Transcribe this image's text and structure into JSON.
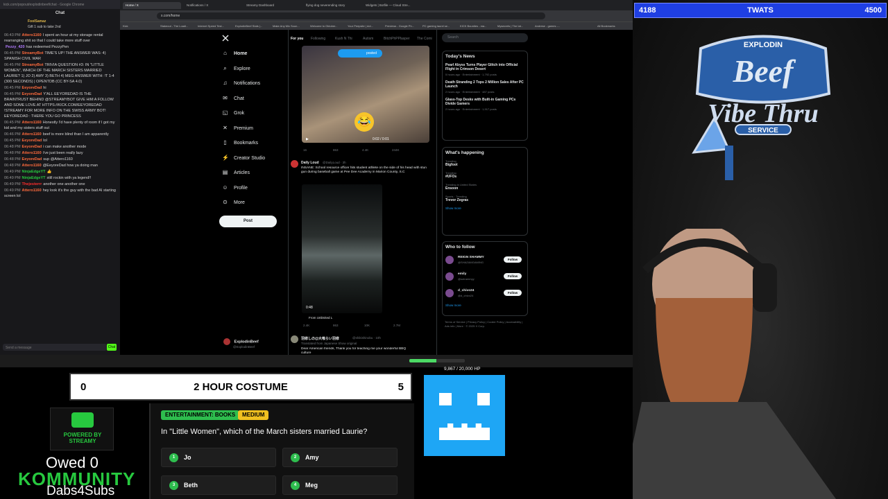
{
  "chat": {
    "window_title": "kick.com/popout/explodinbeef/chat - Google Chrome",
    "title": "Chat",
    "gift_user": "FoolSamaz",
    "gift_text": "Gift 1 sub to take 2nd",
    "messages": [
      {
        "time": "06:43 PM",
        "user": "Attero1160",
        "text": "I spent an hour at my storage rental rearranging shit so that I could take more stuff over",
        "color": "#ff6b3d"
      },
      {
        "time": "",
        "user": "Pezzy_420",
        "text": "has redeemed PezzyPen",
        "color": "#b37cff"
      },
      {
        "time": "06:45 PM",
        "user": "StreamyBot",
        "text": "TIME'S UP! THE ANSWER WAS: 4) SPANISH CIVIL WAR",
        "color": "#ff6b3d"
      },
      {
        "time": "06:45 PM",
        "user": "StreamyBot",
        "text": "TRIVIA QUESTION #3: IN \"LITTLE WOMEN\", WHICH OF THE MARCH SISTERS MARRIED LAURIE? 1) JO 2) AMY 3) BETH 4) MEG ANSWER WITH: !T 1-4 (300 SECONDS) | OPENTDB (CC BY-SA 4.0)",
        "color": "#ff6b3d"
      },
      {
        "time": "06:45 PM",
        "user": "EeyoreDad",
        "text": "hi",
        "color": "#ff6b3d"
      },
      {
        "time": "06:45 PM",
        "user": "EeyoreDad",
        "text": "Y'ALL EEYOREDAD IS THE BRAINTRUST BEHIND @STREAMYBOT GIVE HIM A FOLLOW AND SOME LOVE AT HTTPS://KICK.COM/EEYOREDAD !STREAMY FOR MORE INFO ON THE SWISS ARMY BOT! EEYOREDAD : THERE YOU GO PRINCESS",
        "color": "#ff6b3d"
      },
      {
        "time": "06:45 PM",
        "user": "Attero1160",
        "text": "Honestly I'd have plenty of room if I got my kid and my sisters stuff out",
        "color": "#ff6b3d"
      },
      {
        "time": "06:46 PM",
        "user": "Attero1160",
        "text": "beef is more blind than I am apparently",
        "color": "#ff6b3d"
      },
      {
        "time": "06:45 PM",
        "user": "EeyoreDad",
        "text": "lol",
        "color": "#ff6b3d"
      },
      {
        "time": "06:48 PM",
        "user": "EeyoreDad",
        "text": "i can make another mode",
        "color": "#ff6b3d"
      },
      {
        "time": "06:48 PM",
        "user": "Attero1160",
        "text": "i've just been really lazy",
        "color": "#ff6b3d"
      },
      {
        "time": "06:48 PM",
        "user": "EeyoreDad",
        "text": "sup @Attero1160",
        "color": "#ff6b3d"
      },
      {
        "time": "06:48 PM",
        "user": "Attero1160",
        "text": "@EeyoreDad how ya doing man",
        "color": "#ff6b3d"
      },
      {
        "time": "06:49 PM",
        "user": "NinjaEdgeYT",
        "text": "👍",
        "color": "#27c93f"
      },
      {
        "time": "06:49 PM",
        "user": "NinjaEdgeYT",
        "text": "still rockin with ya legend!!",
        "color": "#27c93f"
      },
      {
        "time": "06:49 PM",
        "user": "Thejesterrr",
        "text": "another one another one",
        "color": "#ff2d2d"
      },
      {
        "time": "06:49 PM",
        "user": "Attero1160",
        "text": "hey look it's the guy with the bad AI starting screen lol",
        "color": "#ff6b3d"
      }
    ],
    "input_placeholder": "Send a message",
    "send_label": "Chat"
  },
  "browser": {
    "tabs": [
      "Home / X",
      "Notifications / X",
      "Streamy Dashboard",
      "flying dog neverending story",
      "Widgets | Botfile — Cloud Stre...",
      ""
    ],
    "url": "x.com/home",
    "bookmarks": [
      "Kick",
      "Stakeout - The Loadi...",
      "Internet Speed Test...",
      "ExplodinBeef Stats |...",
      "Make Any Mix Soun...",
      "Welcome to Oktober...",
      "Your Peepsite | dot...",
      "Previews - Google Ph...",
      "PC gaming laurel se...",
      "KICK Bounties - ma...",
      "Mysecrets | The Iat...",
      "Andrese - games -...",
      "All Bookmarks"
    ]
  },
  "x": {
    "nav": [
      {
        "label": "Home",
        "icon": "home-icon",
        "glyph": "⌂"
      },
      {
        "label": "Explore",
        "icon": "search-icon",
        "glyph": "⌕"
      },
      {
        "label": "Notifications",
        "icon": "bell-icon",
        "glyph": "♫"
      },
      {
        "label": "Chat",
        "icon": "chat-icon",
        "glyph": "✉"
      },
      {
        "label": "Grok",
        "icon": "grok-icon",
        "glyph": "◱"
      },
      {
        "label": "Premium",
        "icon": "premium-icon",
        "glyph": "✕"
      },
      {
        "label": "Bookmarks",
        "icon": "bookmark-icon",
        "glyph": "▯"
      },
      {
        "label": "Creator Studio",
        "icon": "creator-icon",
        "glyph": "⚡"
      },
      {
        "label": "Articles",
        "icon": "articles-icon",
        "glyph": "▤"
      },
      {
        "label": "Profile",
        "icon": "profile-icon",
        "glyph": "☺"
      },
      {
        "label": "More",
        "icon": "more-icon",
        "glyph": "⊙"
      }
    ],
    "post_label": "Post",
    "profile_name": "ExplodinBeef",
    "profile_handle": "@ExplodinBeef",
    "feed_tabs": [
      "For you",
      "Following",
      "Kush N Thi",
      "Autism",
      "BitchPhPPlasper",
      "The Comi"
    ],
    "tweet1": {
      "badge": "posted",
      "time": "0:02 / 0:01",
      "stats": [
        "16",
        "863",
        "4.4K",
        "244K"
      ]
    },
    "tweet2": {
      "user": "Daily Loud",
      "handle": "@DailyLoud · 3h",
      "text": "INSANE: School resource officer hits student athlete on the side of his head with stun gun during baseball game at Pee Dee Academy in Marion County, S.C",
      "duration": "0:48",
      "source": "From Unlimited L",
      "stats": [
        "2.4K",
        "863",
        "10K",
        "2.7M"
      ]
    },
    "tweet3": {
      "user": "羽修しの@大喰らい羽修",
      "handle": "@shikishinobu · 10h",
      "translated": "Translated from Japanese Show original",
      "text": "Dear American friends, Thank you for teaching me your wonderful BBQ culture"
    },
    "search_placeholder": "Search",
    "news_title": "Today's News",
    "news": [
      {
        "title": "Pearl Abyss Turns Player Glitch into Official Flight in Crimson Desert",
        "meta": "5 hours ago · Entertainment · 1,792 posts"
      },
      {
        "title": "Death Stranding 2 Tops 2 Million Sales After PC Launch",
        "meta": "2 hours ago · Entertainment · 487 posts"
      },
      {
        "title": "Glass-Top Desks with Built-in Gaming PCs Divide Gamers",
        "meta": "2 hours ago · Entertainment · 1,917 posts"
      }
    ],
    "happening_title": "What's happening",
    "trends": [
      {
        "context": "Trending",
        "title": "Bigfoot"
      },
      {
        "context": "Trending",
        "title": "#UFOs"
      },
      {
        "context": "Trending in United States",
        "title": "Ensoon"
      },
      {
        "context": "Sports · Trending",
        "title": "Trevor Zegras"
      }
    ],
    "show_more": "Show more",
    "follow_title": "Who to follow",
    "follow": [
      {
        "name": "REIGN SHAMMY",
        "handle": "@SHAZAMGAMING"
      },
      {
        "name": "emily",
        "handle": "@sotrammyy"
      },
      {
        "name": "d_chivo24",
        "handle": "@d_chivo24"
      }
    ],
    "follow_label": "Follow",
    "footer": "Terms of Service | Privacy Policy | Cookie Policy | Accessibility | Ads info | More · © 2025 X Corp."
  },
  "overlay": {
    "top_left": "4188",
    "top_center": "TWATS",
    "top_right": "4500",
    "logo_word1": "EXPLODIN",
    "logo_word2": "Beef",
    "logo_word3": "Vibe Thru",
    "logo_word4": "SERVICE",
    "costume_left": "0",
    "costume_title": "2 HOUR COSTUME",
    "costume_right": "5",
    "streamy_text": "POWERED BY STREAMY",
    "owed": "Owed 0",
    "kommunity": "KOMMUNITY",
    "dabs": "Dabs4Subs",
    "category": "ENTERTAINMENT: BOOKS",
    "difficulty": "MEDIUM",
    "question": "In \"Little Women\", which of the March sisters married Laurie?",
    "answers": [
      {
        "num": "1",
        "text": "Jo"
      },
      {
        "num": "2",
        "text": "Amy"
      },
      {
        "num": "3",
        "text": "Beth"
      },
      {
        "num": "4",
        "text": "Meg"
      }
    ],
    "hp_text": "9,867 / 20,000 HP",
    "hp_fraction": 0.49
  },
  "colors": {
    "accent_blue": "#1f3fe3",
    "kick_green": "#53fc18",
    "x_blue": "#1d9bf0",
    "monster_blue": "#1ea6f5"
  }
}
